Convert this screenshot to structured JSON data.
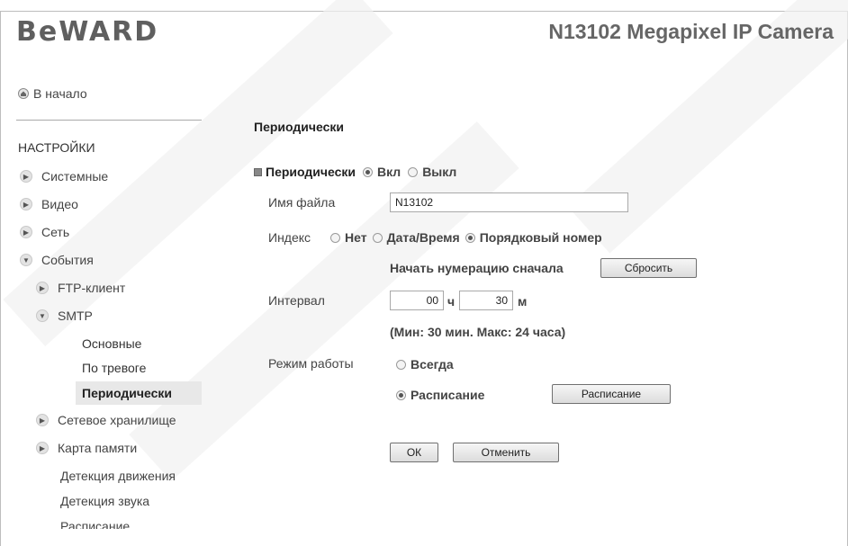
{
  "header": {
    "logo": "BeWARD",
    "model": "N13102 Megapixel IP Camera"
  },
  "sidebar": {
    "home": "В начало",
    "section": "НАСТРОЙКИ",
    "items": [
      {
        "label": "Системные"
      },
      {
        "label": "Видео"
      },
      {
        "label": "Сеть"
      },
      {
        "label": "События"
      },
      {
        "label": "FTP-клиент"
      },
      {
        "label": "SMTP"
      },
      {
        "label": "Основные"
      },
      {
        "label": "По тревоге"
      },
      {
        "label": "Периодически"
      },
      {
        "label": "Сетевое хранилище"
      },
      {
        "label": "Карта памяти"
      },
      {
        "label": "Детекция движения"
      },
      {
        "label": "Детекция звука"
      },
      {
        "label": "Расписание"
      }
    ]
  },
  "form": {
    "title": "Периодически",
    "periodic_label": "Периодически",
    "on_label": "Вкл",
    "off_label": "Выкл",
    "filename_label": "Имя файла",
    "filename_value": "N13102",
    "index_label": "Индекс",
    "index_none": "Нет",
    "index_datetime": "Дата/Время",
    "index_seq": "Порядковый номер",
    "reset_numbering_label": "Начать нумерацию сначала",
    "reset_button": "Сбросить",
    "interval_label": "Интервал",
    "interval_hours": "00",
    "hours_unit": "ч",
    "interval_minutes": "30",
    "minutes_unit": "м",
    "interval_hint": "(Мин: 30 мин. Макс: 24 часа)",
    "mode_label": "Режим работы",
    "mode_always": "Всегда",
    "mode_schedule": "Расписание",
    "schedule_button": "Расписание",
    "ok_button": "ОК",
    "cancel_button": "Отменить"
  }
}
